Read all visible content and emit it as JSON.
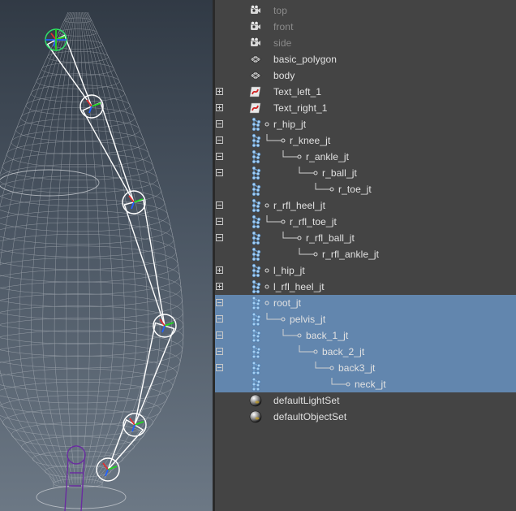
{
  "outliner": {
    "rows": [
      {
        "label": "top",
        "icon": "camera-icon",
        "dim": true,
        "expander": "",
        "depth": 0,
        "selected": false
      },
      {
        "label": "front",
        "icon": "camera-icon",
        "dim": true,
        "expander": "",
        "depth": 0,
        "selected": false
      },
      {
        "label": "side",
        "icon": "camera-icon",
        "dim": true,
        "expander": "",
        "depth": 0,
        "selected": false
      },
      {
        "label": "basic_polygon",
        "icon": "mesh-icon",
        "dim": false,
        "expander": "",
        "depth": 0,
        "selected": false
      },
      {
        "label": "body",
        "icon": "mesh-icon",
        "dim": false,
        "expander": "",
        "depth": 0,
        "selected": false
      },
      {
        "label": "Text_left_1",
        "icon": "curve-icon",
        "dim": false,
        "expander": "plus",
        "depth": 0,
        "selected": false
      },
      {
        "label": "Text_right_1",
        "icon": "curve-icon",
        "dim": false,
        "expander": "plus",
        "depth": 0,
        "selected": false
      },
      {
        "label": "r_hip_jt",
        "icon": "joint-icon",
        "dim": false,
        "expander": "minus",
        "depth": 0,
        "selected": false
      },
      {
        "label": "r_knee_jt",
        "icon": "joint-icon",
        "dim": false,
        "expander": "minus",
        "depth": 1,
        "selected": false
      },
      {
        "label": "r_ankle_jt",
        "icon": "joint-icon",
        "dim": false,
        "expander": "minus",
        "depth": 2,
        "selected": false
      },
      {
        "label": "r_ball_jt",
        "icon": "joint-icon",
        "dim": false,
        "expander": "minus",
        "depth": 3,
        "selected": false
      },
      {
        "label": "r_toe_jt",
        "icon": "joint-icon",
        "dim": false,
        "expander": "",
        "depth": 4,
        "selected": false
      },
      {
        "label": "r_rfl_heel_jt",
        "icon": "joint-icon",
        "dim": false,
        "expander": "minus",
        "depth": 0,
        "selected": false
      },
      {
        "label": "r_rfl_toe_jt",
        "icon": "joint-icon",
        "dim": false,
        "expander": "minus",
        "depth": 1,
        "selected": false
      },
      {
        "label": "r_rfl_ball_jt",
        "icon": "joint-icon",
        "dim": false,
        "expander": "minus",
        "depth": 2,
        "selected": false
      },
      {
        "label": "r_rfl_ankle_jt",
        "icon": "joint-icon",
        "dim": false,
        "expander": "",
        "depth": 3,
        "selected": false
      },
      {
        "label": "l_hip_jt",
        "icon": "joint-icon",
        "dim": false,
        "expander": "plus",
        "depth": 0,
        "selected": false
      },
      {
        "label": "l_rfl_heel_jt",
        "icon": "joint-icon",
        "dim": false,
        "expander": "plus",
        "depth": 0,
        "selected": false
      },
      {
        "label": "root_jt",
        "icon": "joint-icon",
        "dim": false,
        "expander": "minus",
        "depth": 0,
        "selected": true
      },
      {
        "label": "pelvis_jt",
        "icon": "joint-icon",
        "dim": false,
        "expander": "minus",
        "depth": 1,
        "selected": true
      },
      {
        "label": "back_1_jt",
        "icon": "joint-icon",
        "dim": false,
        "expander": "minus",
        "depth": 2,
        "selected": true
      },
      {
        "label": "back_2_jt",
        "icon": "joint-icon",
        "dim": false,
        "expander": "minus",
        "depth": 3,
        "selected": true
      },
      {
        "label": "back3_jt",
        "icon": "joint-icon",
        "dim": false,
        "expander": "minus",
        "depth": 4,
        "selected": true
      },
      {
        "label": "neck_jt",
        "icon": "joint-icon",
        "dim": false,
        "expander": "",
        "depth": 5,
        "selected": true
      },
      {
        "label": "defaultLightSet",
        "icon": "set-icon",
        "dim": false,
        "expander": "",
        "depth": 0,
        "selected": false
      },
      {
        "label": "defaultObjectSet",
        "icon": "set-icon",
        "dim": false,
        "expander": "",
        "depth": 0,
        "selected": false
      }
    ]
  },
  "colors": {
    "selection": "#6286ae",
    "panel": "#444444",
    "joint": "#ffffff",
    "wireframe": "#c9cdd2",
    "joint_icon": "#7fb4e6",
    "axis_x": "#e03030",
    "axis_y": "#22d622",
    "axis_z": "#2060ff",
    "ik_handle": "#6a2ca0"
  }
}
